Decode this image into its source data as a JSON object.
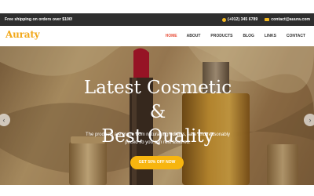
{
  "topbar": {
    "shipping_text": "Free shipping on orders over $100!",
    "phone": "(+012) 345 6789",
    "email": "contact@auura.com",
    "phone_icon": "phone-icon",
    "email_icon": "mail-icon"
  },
  "header": {
    "logo": "Auraty",
    "nav": [
      "HOME",
      "ABOUT",
      "PRODUCTS",
      "BLOG",
      "LINKS",
      "CONTACT"
    ],
    "active_nav": "HOME"
  },
  "hero": {
    "title_line1": "Latest Cosmetic &",
    "title_line2": "Best Quality",
    "description_line1": "The products are made from natural ingredients, safe and reasonably",
    "description_line2": "priced so you can rest assured.",
    "cta_label": "GET 50% OFF NOW",
    "prev_arrow": "‹",
    "next_arrow": "›"
  },
  "colors": {
    "accent": "#f7b50f",
    "nav_active": "#e84f3a",
    "topbar_bg": "#2e2e2e",
    "logo": "#f2a91c"
  }
}
